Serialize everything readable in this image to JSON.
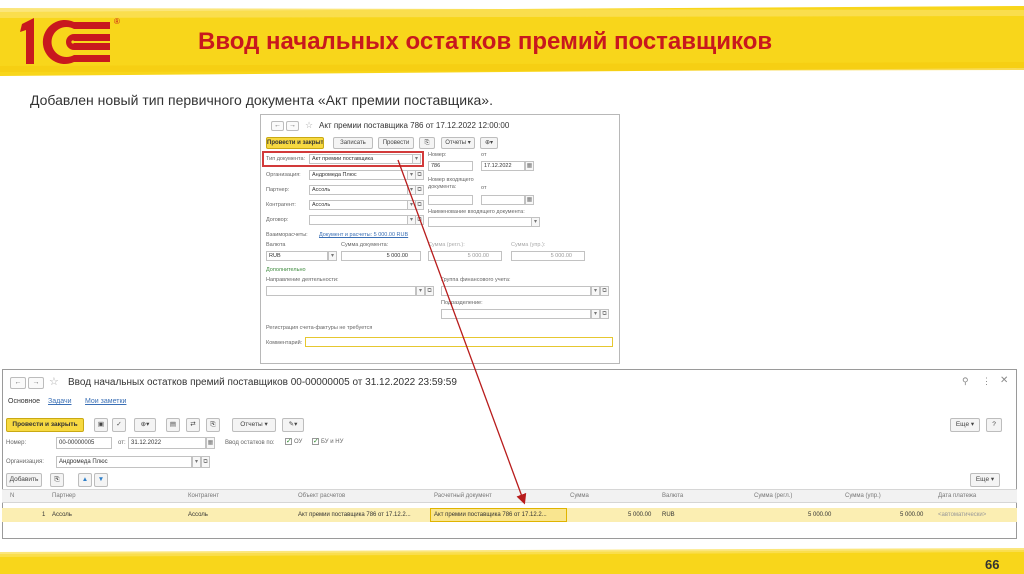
{
  "slide": {
    "title": "Ввод начальных остатков премий поставщиков",
    "subtitle": "Добавлен новый тип первичного документа «Акт премии поставщика».",
    "page_number": "66",
    "logo_text": "1C"
  },
  "small_window": {
    "title": "Акт премии поставщика 786 от 17.12.2022 12:00:00",
    "buttons": {
      "post_close": "Провести и закрыть",
      "save": "Записать",
      "post": "Провести",
      "reports": "Отчеты ▾"
    },
    "fields": {
      "doc_type_label": "Тип документа:",
      "doc_type_value": "Акт премии поставщика",
      "number_label": "Номер:",
      "number_value": "786",
      "from_label": "от",
      "date_value": "17.12.2022",
      "org_label": "Организация:",
      "org_value": "Андромеда Плюс",
      "partner_label": "Партнер:",
      "partner_value": "Ассоль",
      "contractor_label": "Контрагент:",
      "contractor_value": "Ассоль",
      "contract_label": "Договор:",
      "incoming_number_label": "Номер входящего документа:",
      "incoming_from_label": "от",
      "incoming_name_label": "Наименование входящего документа:",
      "settlements_label": "Взаиморасчеты:",
      "settlements_link": "Документ и расчеты: 5 000.00 RUB",
      "currency_label": "Валюта",
      "currency_value": "RUB",
      "doc_sum_label": "Сумма документа:",
      "doc_sum_value": "5 000.00",
      "sum_reg_label": "Сумма (регл.):",
      "sum_reg_value": "5 000.00",
      "sum_upr_label": "Сумма (упр.):",
      "sum_upr_value": "5 000.00",
      "additional_label": "Дополнительно",
      "activity_label": "Направление деятельности:",
      "fin_group_label": "Группа финансового учета:",
      "division_label": "Подразделение:",
      "invoice_text": "Регистрация счета-фактуры не требуется",
      "comment_label": "Комментарий:"
    }
  },
  "large_window": {
    "title": "Ввод начальных остатков премий поставщиков 00-00000005 от 31.12.2022 23:59:59",
    "tabs": [
      "Основное",
      "Задачи",
      "Мои заметки"
    ],
    "buttons": {
      "post_close": "Провести и закрыть",
      "reports": "Отчеты ▾",
      "more": "Еще ▾",
      "help": "?",
      "add": "Добавить",
      "more2": "Еще ▾"
    },
    "fields": {
      "number_label": "Номер:",
      "number_value": "00-00000005",
      "from_label": "от:",
      "date_value": "31.12.2022",
      "input_label": "Ввод остатков по:",
      "ou_label": "ОУ",
      "bu_label": "БУ и НУ",
      "org_label": "Организация:",
      "org_value": "Андромеда Плюс"
    },
    "table": {
      "columns": [
        "N",
        "Партнер",
        "Контрагент",
        "Объект расчетов",
        "Расчетный документ",
        "Сумма",
        "Валюта",
        "Сумма (регл.)",
        "Сумма (упр.)",
        "Дата платежа"
      ],
      "rows": [
        [
          "1",
          "Ассоль",
          "Ассоль",
          "Акт премии поставщика 786 от 17.12.2...",
          "Акт премии поставщика 786 от 17.12.2...",
          "5 000.00",
          "RUB",
          "5 000.00",
          "5 000.00",
          "<автоматически>"
        ]
      ]
    }
  },
  "colors": {
    "accent_red": "#c8181e",
    "highlight_yellow": "#fbeeb2",
    "button_yellow": "#f7d941",
    "arrow_red": "#b81c1c"
  }
}
